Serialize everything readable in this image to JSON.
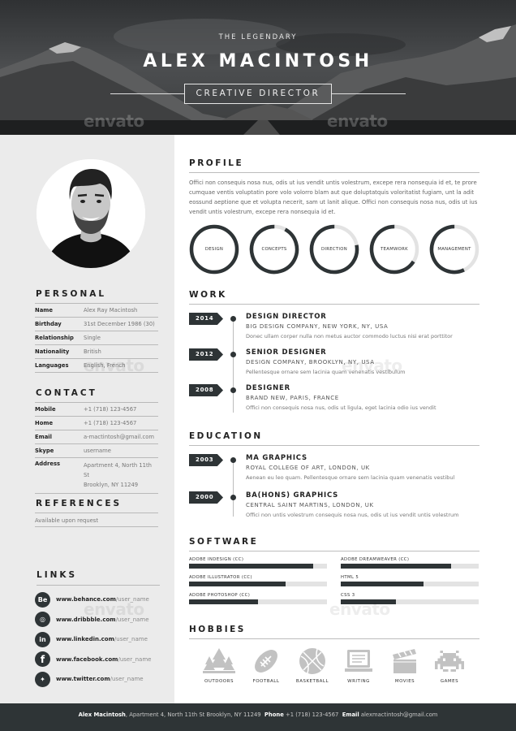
{
  "header": {
    "tagline": "THE LEGENDARY",
    "name": "ALEX MACINTOSH",
    "role": "CREATIVE DIRECTOR",
    "watermark": "envato"
  },
  "sidebar": {
    "personal": {
      "title": "PERSONAL",
      "rows": [
        {
          "label": "Name",
          "value": "Alex Ray Macintosh"
        },
        {
          "label": "Birthday",
          "value": "31st December 1986 (30)"
        },
        {
          "label": "Relationship",
          "value": "Single"
        },
        {
          "label": "Nationality",
          "value": "British"
        },
        {
          "label": "Languages",
          "value": "English, French"
        }
      ]
    },
    "contact": {
      "title": "CONTACT",
      "rows": [
        {
          "label": "Mobile",
          "value": "+1 (718) 123-4567"
        },
        {
          "label": "Home",
          "value": "+1 (718) 123-4567"
        },
        {
          "label": "Email",
          "value": "a-mactintosh@gmail.com"
        },
        {
          "label": "Skype",
          "value": "username"
        },
        {
          "label": "Address",
          "value": "Apartment 4, North 11th St",
          "value2": "Brooklyn, NY 11249"
        }
      ]
    },
    "references": {
      "title": "REFERENCES",
      "text": "Available upon request"
    },
    "links": {
      "title": "LINKS",
      "items": [
        {
          "icon": "behance-icon",
          "glyph": "Be",
          "domain": "www.behance.com",
          "user": "/user_name"
        },
        {
          "icon": "dribbble-icon",
          "glyph": "◎",
          "domain": "www.dribbble.com",
          "user": "/user_name"
        },
        {
          "icon": "linkedin-icon",
          "glyph": "in",
          "domain": "www.linkedin.com",
          "user": "/user_name"
        },
        {
          "icon": "facebook-icon",
          "glyph": "f",
          "domain": "www.facebook.com",
          "user": "/user_name"
        },
        {
          "icon": "twitter-icon",
          "glyph": "✦",
          "domain": "www.twitter.com",
          "user": "/user_name"
        }
      ]
    }
  },
  "main": {
    "profile": {
      "title": "PROFILE",
      "text": "Offici non consequis nosa nus, odis ut ius vendit untis volestrum, excepe rera nonsequia id et, te prore cumquae ventis voluptatin pore volo volorro blam aut que doluptatquis voloritatist fugiam, unt la adit eossund aeptione que et volupta necerit, sam ut lanit alique. Offici non consequis nosa nus, odis ut ius vendit untis volestrum, excepe rera nonsequia id et."
    },
    "skills": [
      {
        "label": "DESIGN",
        "percent": 100
      },
      {
        "label": "CONCEPTS",
        "percent": 92
      },
      {
        "label": "DIRECTION",
        "percent": 78
      },
      {
        "label": "TEAMWORK",
        "percent": 66
      },
      {
        "label": "MANAGEMENT",
        "percent": 57
      }
    ],
    "work": {
      "title": "WORK",
      "items": [
        {
          "year": "2014",
          "title": "DESIGN DIRECTOR",
          "org": "BIG DESIGN COMPANY, NEW YORK, NY, USA",
          "desc": "Donec ullam corper nulla non metus auctor commodo luctus nisi erat porttitor"
        },
        {
          "year": "2012",
          "title": "SENIOR DESIGNER",
          "org": "DESIGN COMPANY, BROOKLYN, NY, USA",
          "desc": "Pellentesque ornare sem lacinia quam venenatis vestibulum"
        },
        {
          "year": "2008",
          "title": "DESIGNER",
          "org": "BRAND NEW, PARIS, FRANCE",
          "desc": "Offici non consequis nosa nus, odis ut ligula, eget lacinia odio ius vendit"
        }
      ]
    },
    "education": {
      "title": "EDUCATION",
      "items": [
        {
          "year": "2003",
          "title": "MA GRAPHICS",
          "org": "ROYAL COLLEGE OF ART, LONDON, UK",
          "desc": "Aenean eu leo quam. Pellentesque ornare sem lacinia quam venenatis vestibul"
        },
        {
          "year": "2000",
          "title": "BA(HONS) GRAPHICS",
          "org": "CENTRAL SAINT MARTINS, LONDON, UK",
          "desc": "Offici non untis volestrum consequis nosa nus, odis ut ius vendit untis volestrum"
        }
      ]
    },
    "software": {
      "title": "SOFTWARE",
      "items": [
        {
          "name": "ADOBE INDESIGN (CC)",
          "percent": 90
        },
        {
          "name": "ADOBE ILLUSTRATOR (CC)",
          "percent": 70
        },
        {
          "name": "ADOBE PHOTOSHOP (CC)",
          "percent": 50
        },
        {
          "name": "ADOBE DREAMWEAVER (CC)",
          "percent": 80
        },
        {
          "name": "HTML 5",
          "percent": 60
        },
        {
          "name": "CSS 3",
          "percent": 40
        }
      ]
    },
    "hobbies": {
      "title": "HOBBIES",
      "items": [
        {
          "icon": "trees-icon",
          "label": "OUTDOORS"
        },
        {
          "icon": "football-icon",
          "label": "FOOTBALL"
        },
        {
          "icon": "basketball-icon",
          "label": "BASKETBALL"
        },
        {
          "icon": "laptop-icon",
          "label": "WRITING"
        },
        {
          "icon": "clapperboard-icon",
          "label": "MOVIES"
        },
        {
          "icon": "space-invader-icon",
          "label": "GAMES"
        }
      ]
    }
  },
  "footer": {
    "name": "Alex Macintosh",
    "address": ", Apartment 4, North 11th St Brooklyn, NY 11249",
    "phone_label": "Phone",
    "phone": " +1 (718) 123-4567",
    "email_label": "Email",
    "email": " alexmactintosh@gmail.com"
  },
  "colors": {
    "dark": "#2e3436",
    "sidebar_bg": "#ebebeb",
    "track": "#e3e3e3",
    "rule": "#bdbdbd"
  }
}
